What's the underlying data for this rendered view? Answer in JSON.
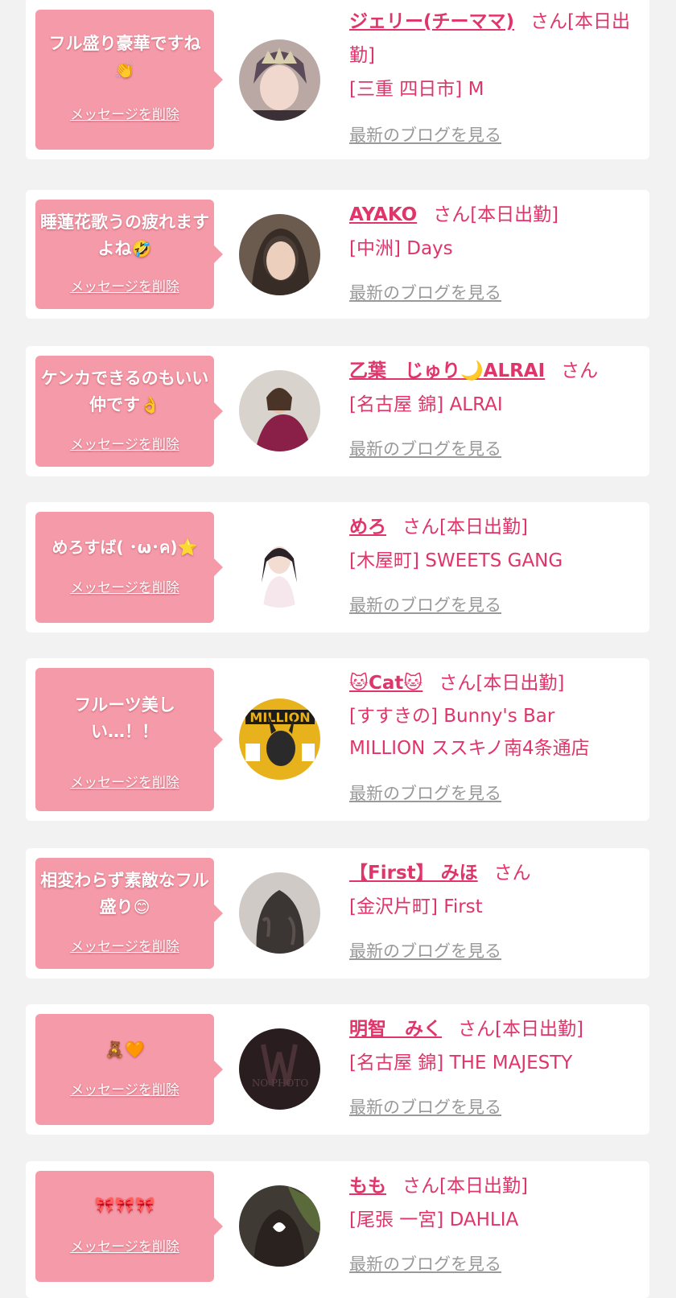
{
  "delete_label": "メッセージを削除",
  "blog_label": "最新のブログを見る",
  "colors": {
    "accent": "#e0356b",
    "bubble": "#f59aa8",
    "link_gray": "#999999"
  },
  "items": [
    {
      "message_text": "フル盛り豪華ですね",
      "message_emoji": "👏",
      "name": "ジェリー(チーママ)",
      "suffix": "さん[本日出勤]",
      "shop": "[三重 四日市] M"
    },
    {
      "message_text": "睡蓮花歌うの疲れますよね",
      "message_emoji": "🤣",
      "name": "AYAKO",
      "suffix": "さん[本日出勤]",
      "shop": "[中洲] Days"
    },
    {
      "message_text": "ケンカできるのもいい仲です",
      "message_emoji": "👌",
      "name": "乙葉　じゅり🌙ALRAI",
      "suffix": "さん",
      "shop": "[名古屋 錦] ALRAI"
    },
    {
      "message_text": "めろすば( ･ω･ค)",
      "message_emoji": "⭐",
      "name": "めろ",
      "suffix": "さん[本日出勤]",
      "shop": "[木屋町] SWEETS GANG"
    },
    {
      "message_text": "フルーツ美しい…！！",
      "message_emoji": "",
      "name": "🐱Cat🐱",
      "suffix": "さん[本日出勤]",
      "shop": "[すすきの] Bunny's Bar MILLION ススキノ南4条通店"
    },
    {
      "message_text": "相変わらず素敵なフル盛り",
      "message_emoji": "😊",
      "name": "【First】 みほ",
      "suffix": "さん",
      "shop": "[金沢片町] First"
    },
    {
      "message_text": "",
      "message_emoji": "🧸🧡",
      "name": "明智　みく",
      "suffix": "さん[本日出勤]",
      "shop": "[名古屋 錦] THE MAJESTY"
    },
    {
      "message_text": "",
      "message_emoji": "🎀🎀🎀",
      "name": "もも",
      "suffix": "さん[本日出勤]",
      "shop": "[尾張 一宮] DAHLIA"
    }
  ]
}
